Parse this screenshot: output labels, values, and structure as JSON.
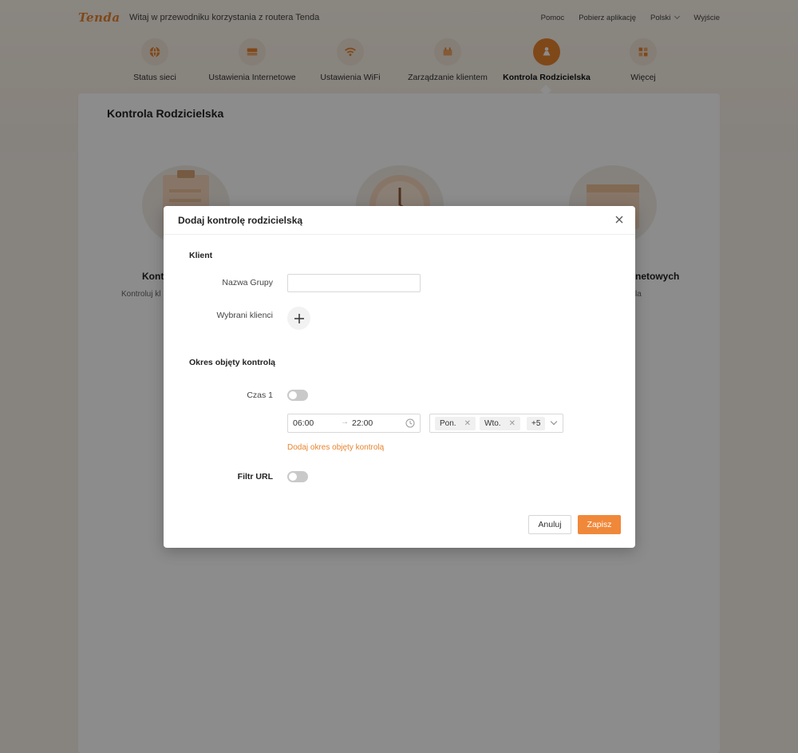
{
  "header": {
    "brand": "Tenda",
    "welcome": "Witaj w przewodniku korzystania z routera Tenda",
    "links": {
      "help": "Pomoc",
      "download_app": "Pobierz aplikację",
      "language": "Polski",
      "logout": "Wyjście"
    }
  },
  "nav": {
    "items": [
      {
        "label": "Status sieci",
        "icon": "globe-icon"
      },
      {
        "label": "Ustawienia Internetowe",
        "icon": "router-icon"
      },
      {
        "label": "Ustawienia WiFi",
        "icon": "wifi-icon"
      },
      {
        "label": "Zarządzanie klientem",
        "icon": "devices-icon"
      },
      {
        "label": "Kontrola Rodzicielska",
        "icon": "family-icon",
        "active": true
      },
      {
        "label": "Więcej",
        "icon": "grid-icon"
      }
    ]
  },
  "page": {
    "title": "Kontrola Rodzicielska",
    "features": [
      {
        "title_fragment": "Kont",
        "desc_fragment": "Kontroluj kl"
      },
      {
        "title_fragment": "netowych",
        "desc_fragment": "la"
      }
    ]
  },
  "modal": {
    "title": "Dodaj kontrolę rodzicielską",
    "client_section": "Klient",
    "group_name_label": "Nazwa Grupy",
    "group_name_value": "",
    "selected_clients_label": "Wybrani klienci",
    "period_section": "Okres objęty kontrolą",
    "time1_label": "Czas 1",
    "time1_enabled": false,
    "time_start": "06:00",
    "time_arrow": "→",
    "time_end": "22:00",
    "days": [
      "Pon.",
      "Wto."
    ],
    "days_more": "+5",
    "add_period_label": "Dodaj okres objęty kontrolą",
    "url_filter_label": "Filtr URL",
    "url_filter_enabled": false,
    "cancel_label": "Anuluj",
    "save_label": "Zapisz"
  },
  "colors": {
    "accent": "#e8842f",
    "save_button": "#f0883a"
  }
}
